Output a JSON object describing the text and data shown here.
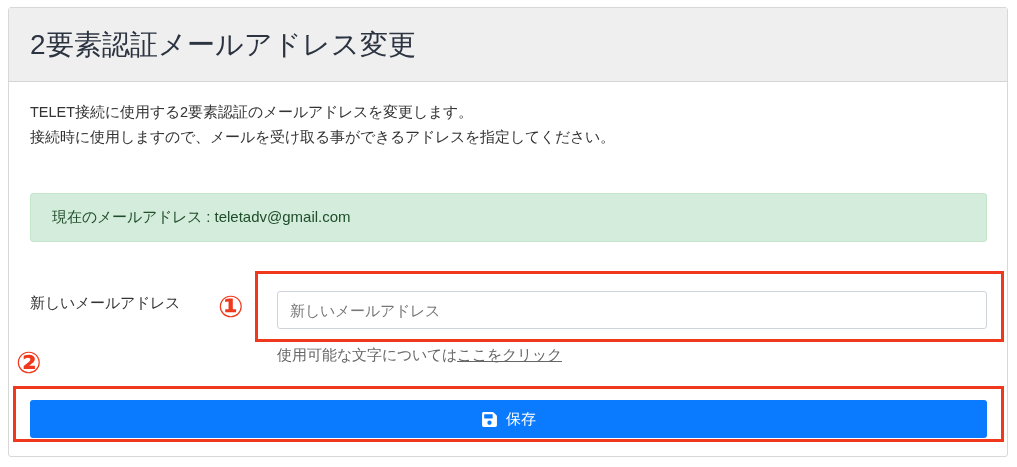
{
  "card": {
    "title": "2要素認証メールアドレス変更",
    "description": [
      "TELET接続に使用する2要素認証のメールアドレスを変更します。",
      "接続時に使用しますので、メールを受け取る事ができるアドレスを指定してください。"
    ],
    "alert": "現在のメールアドレス : teletadv@gmail.com",
    "form": {
      "label": "新しいメールアドレス",
      "placeholder": "新しいメールアドレス",
      "hint": "使用可能な文字については",
      "hint_link": "ここをクリック"
    },
    "save_button": "保存"
  },
  "annotations": [
    {
      "label": "①",
      "kind": "field"
    },
    {
      "label": "②",
      "kind": "button"
    }
  ]
}
